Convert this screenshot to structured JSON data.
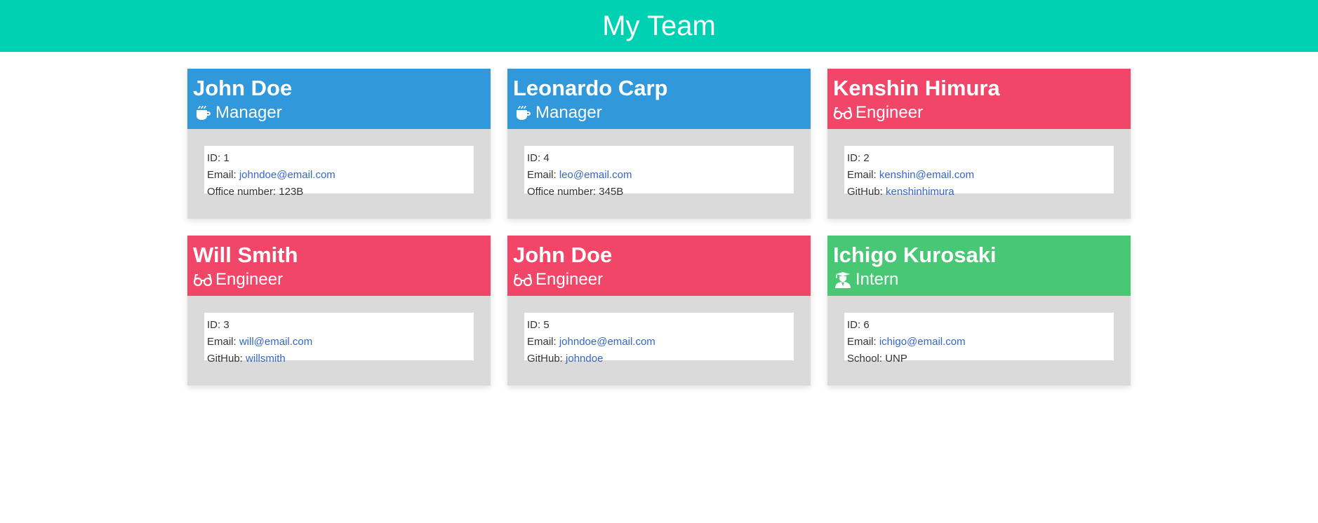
{
  "header": {
    "title": "My Team"
  },
  "colors": {
    "banner": "#00d1b2",
    "manager": "#3298dc",
    "engineer": "#f14668",
    "intern": "#48c774",
    "link": "#3366cc",
    "card_body": "#dadada"
  },
  "cards": [
    {
      "name": "John Doe",
      "role": "Manager",
      "icon": "coffee-icon",
      "color": "#3298dc",
      "id": "ID: 1",
      "email_label": "Email: ",
      "email": "johndoe@email.com",
      "extra_label": "Office number: 123B",
      "extra_value": ""
    },
    {
      "name": "Leonardo Carp",
      "role": "Manager",
      "icon": "coffee-icon",
      "color": "#3298dc",
      "id": "ID: 4",
      "email_label": "Email: ",
      "email": "leo@email.com",
      "extra_label": "Office number: 345B",
      "extra_value": ""
    },
    {
      "name": "Kenshin Himura",
      "role": "Engineer",
      "icon": "glasses-icon",
      "color": "#f14668",
      "id": "ID: 2",
      "email_label": "Email: ",
      "email": "kenshin@email.com",
      "extra_label": "GitHub: ",
      "extra_value": "kenshinhimura"
    },
    {
      "name": "Will Smith",
      "role": "Engineer",
      "icon": "glasses-icon",
      "color": "#f14668",
      "id": "ID: 3",
      "email_label": "Email: ",
      "email": "will@email.com",
      "extra_label": "GitHub: ",
      "extra_value": "willsmith"
    },
    {
      "name": "John Doe",
      "role": "Engineer",
      "icon": "glasses-icon",
      "color": "#f14668",
      "id": "ID: 5",
      "email_label": "Email: ",
      "email": "johndoe@email.com",
      "extra_label": "GitHub: ",
      "extra_value": "johndoe"
    },
    {
      "name": "Ichigo Kurosaki",
      "role": "Intern",
      "icon": "graduate-icon",
      "color": "#48c774",
      "id": "ID: 6",
      "email_label": "Email: ",
      "email": "ichigo@email.com",
      "extra_label": "School: UNP",
      "extra_value": ""
    }
  ]
}
